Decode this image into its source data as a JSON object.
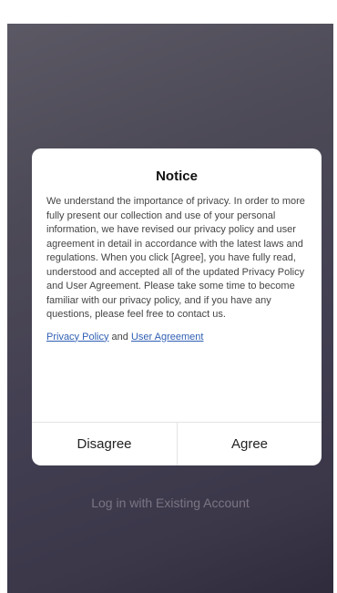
{
  "background": {
    "login_existing_label": "Log in with Existing Account"
  },
  "dialog": {
    "title": "Notice",
    "body": "We understand the importance of privacy. In order to more fully present our collection and use of your personal information, we have revised our privacy policy and user agreement in detail in accordance with the latest laws and regulations. When you click [Agree], you have fully read, understood and accepted all of the updated Privacy Policy and User Agreement. Please take some time to become familiar with our privacy policy, and if you have any questions, please feel free to contact us.",
    "privacy_policy_link": "Privacy Policy",
    "links_conjunction": "and",
    "user_agreement_link": "User Agreement",
    "disagree_label": "Disagree",
    "agree_label": "Agree"
  },
  "colors": {
    "link": "#2f5fb3",
    "backdrop": "#433f52"
  }
}
